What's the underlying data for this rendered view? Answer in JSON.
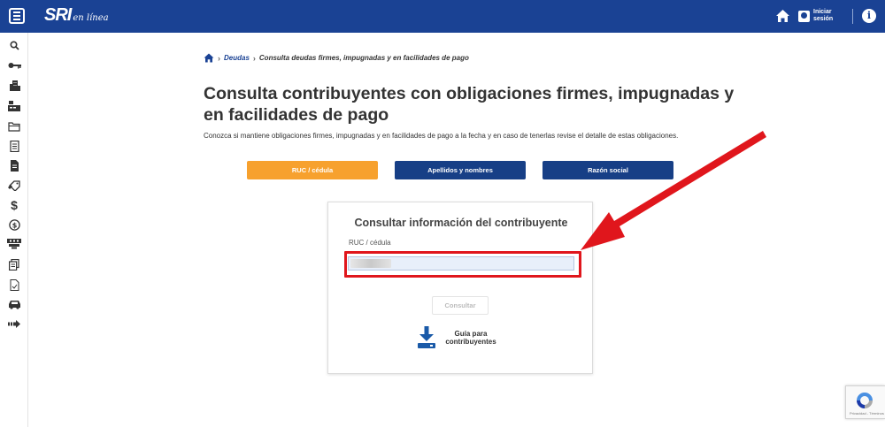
{
  "header": {
    "logo_main": "SRI",
    "logo_sub": "en línea",
    "login_label": "Iniciar sesión",
    "info_symbol": "i"
  },
  "sidebar": {
    "icons": [
      "search-icon",
      "key-icon",
      "building-icon",
      "cash-register-icon",
      "folder-icon",
      "document-list-icon",
      "document-icon",
      "tag-icon",
      "dollar-icon",
      "coin-icon",
      "handshake-icon",
      "copy-documents-icon",
      "form-icon",
      "car-icon",
      "arrow-right-icon"
    ]
  },
  "breadcrumb": {
    "link": "Deudas",
    "current": "Consulta deudas firmes, impugnadas y en facilidades de pago"
  },
  "page": {
    "title": "Consulta contribuyentes con obligaciones firmes, impugnadas y en facilidades de pago",
    "description": "Conozca si mantiene obligaciones firmes, impugnadas y en facilidades de pago a la fecha y en caso de tenerlas revise el detalle de estas obligaciones."
  },
  "tabs": [
    {
      "label": "RUC / cédula",
      "active": true
    },
    {
      "label": "Apellidos y nombres",
      "active": false
    },
    {
      "label": "Razón social",
      "active": false
    }
  ],
  "card": {
    "title": "Consultar información del contribuyente",
    "field_label": "RUC / cédula",
    "field_value": "001",
    "consult_label": "Consultar",
    "guide_label": "Guía para contribuyentes"
  },
  "recaptcha": {
    "footer": "Privacidad - Términos"
  },
  "colors": {
    "brand_blue": "#1a4294",
    "accent_orange": "#f7a12e",
    "annotation_red": "#e0161c"
  }
}
